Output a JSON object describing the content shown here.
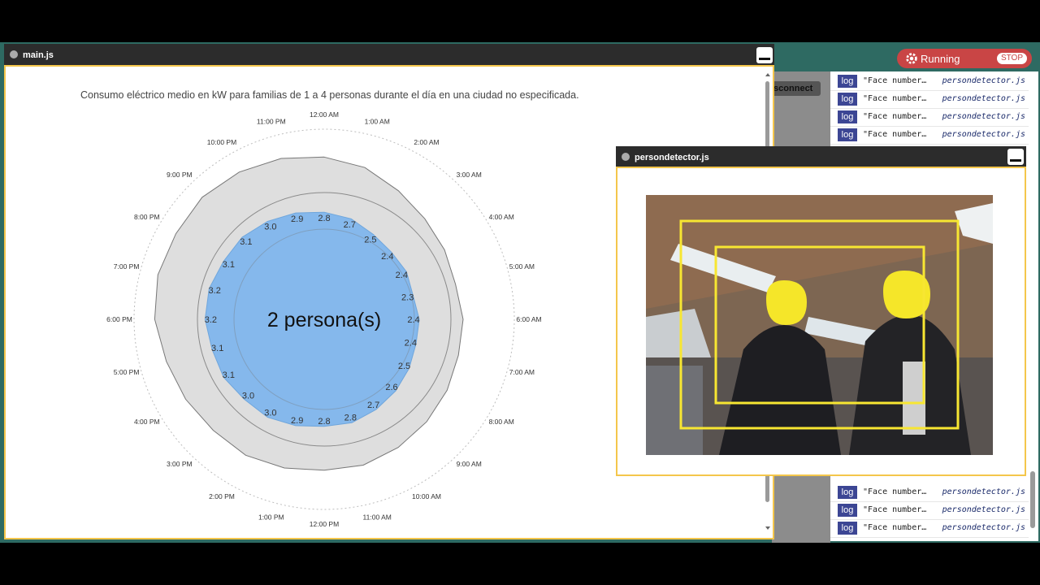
{
  "main_window": {
    "title": "main.js"
  },
  "detector_window": {
    "title": "persondetector.js"
  },
  "status": {
    "label": "Running",
    "stop_label": "STOP"
  },
  "disconnect_label": "isconnect",
  "console": {
    "rows": [
      {
        "level": "log",
        "message": "\"Face number…",
        "source": "persondetector.js"
      },
      {
        "level": "log",
        "message": "\"Face number…",
        "source": "persondetector.js"
      },
      {
        "level": "log",
        "message": "\"Face number…",
        "source": "persondetector.js"
      },
      {
        "level": "log",
        "message": "\"Face number…",
        "source": "persondetector.js"
      },
      {
        "level": "log",
        "message": "\"Face number…",
        "source": "persondetector.js"
      },
      {
        "level": "log",
        "message": "\"Face number…",
        "source": "persondetector.js"
      },
      {
        "level": "log",
        "message": "\"Face number…",
        "source": "persondetector.js"
      }
    ]
  },
  "chart_data": {
    "type": "radial-area",
    "title": "Consumo eléctrico medio en kW para familias de 1 a 4 personas durante el día en una ciudad no especificada.",
    "center_label": "2 persona(s)",
    "hours": [
      "12:00 AM",
      "1:00 AM",
      "2:00 AM",
      "3:00 AM",
      "4:00 AM",
      "5:00 AM",
      "6:00 AM",
      "7:00 AM",
      "8:00 AM",
      "9:00 AM",
      "10:00 AM",
      "11:00 AM",
      "12:00 PM",
      "1:00 PM",
      "2:00 PM",
      "3:00 PM",
      "4:00 PM",
      "5:00 PM",
      "6:00 PM",
      "7:00 PM",
      "8:00 PM",
      "9:00 PM",
      "10:00 PM",
      "11:00 PM"
    ],
    "series": [
      {
        "name": "2 persona(s)",
        "values": [
          2.8,
          2.7,
          2.5,
          2.4,
          2.4,
          2.3,
          2.4,
          2.4,
          2.5,
          2.6,
          2.7,
          2.8,
          2.8,
          2.9,
          3.0,
          3.0,
          3.1,
          3.1,
          3.2,
          3.2,
          3.1,
          3.1,
          3.0,
          2.9
        ],
        "color": "#85b8ec"
      }
    ],
    "colors": {
      "selected": "#85b8ec",
      "other": "#dedede"
    }
  },
  "camera": {
    "detections": 2
  }
}
